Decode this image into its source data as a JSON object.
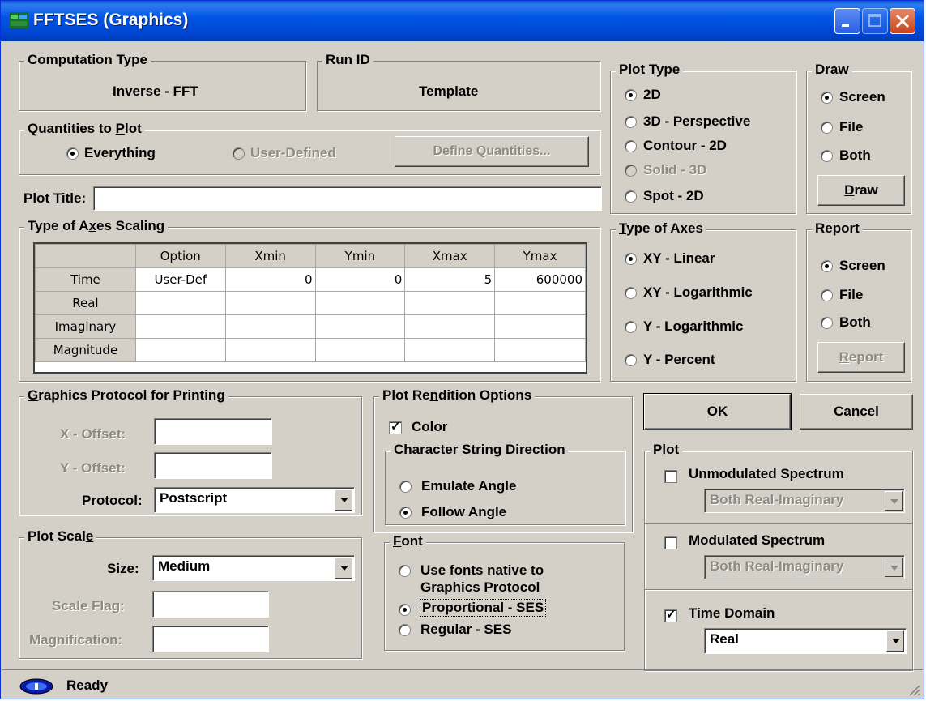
{
  "window": {
    "title": "FFTSES (Graphics)"
  },
  "computation_type": {
    "label": "Computation Type",
    "value": "Inverse - FFT"
  },
  "run_id": {
    "label": "Run ID",
    "value": "Template"
  },
  "quantities": {
    "label_pre": "Quantities to ",
    "label_u": "P",
    "label_post": "lot",
    "everything": "Everything",
    "user_defined": "User-Defined",
    "define_button": "Define Quantities..."
  },
  "plot_title": {
    "label": "Plot Title:",
    "value": ""
  },
  "axes_scaling": {
    "label_pre": "Type of A",
    "label_u": "x",
    "label_post": "es Scaling",
    "headers": [
      "",
      "Option",
      "Xmin",
      "Ymin",
      "Xmax",
      "Ymax"
    ],
    "rows": [
      [
        "Time",
        "User-Def",
        "0",
        "0",
        "5",
        "600000"
      ],
      [
        "Real",
        "",
        "",
        "",
        "",
        ""
      ],
      [
        "Imaginary",
        "",
        "",
        "",
        "",
        ""
      ],
      [
        "Magnitude",
        "",
        "",
        "",
        "",
        ""
      ]
    ]
  },
  "plot_type": {
    "label_pre": "Plot ",
    "label_u": "T",
    "label_post": "ype",
    "options": [
      "2D",
      "3D - Perspective",
      "Contour - 2D",
      "Solid - 3D",
      "Spot - 2D"
    ],
    "selected": "2D"
  },
  "draw": {
    "label_pre": "Dra",
    "label_u": "w",
    "label_post": "",
    "options": [
      "Screen",
      "File",
      "Both"
    ],
    "selected": "Screen",
    "button_u": "D",
    "button_rest": "raw"
  },
  "axes_type": {
    "label_pre": "",
    "label_u": "T",
    "label_post": "ype of Axes",
    "options": [
      "XY - Linear",
      "XY - Logarithmic",
      "Y - Logarithmic",
      "Y - Percent"
    ],
    "selected": "XY - Linear"
  },
  "report": {
    "label": "Report",
    "options": [
      "Screen",
      "File",
      "Both"
    ],
    "selected": "Screen",
    "button_u": "R",
    "button_rest": "eport"
  },
  "graphics_protocol": {
    "label_pre": "",
    "label_u": "G",
    "label_post": "raphics Protocol for Printing",
    "x_offset": "X - Offset:",
    "y_offset": "Y - Offset:",
    "protocol_label": "Protocol:",
    "protocol_value": "Postscript"
  },
  "plot_scale": {
    "label_pre": "Plot Scal",
    "label_u": "e",
    "label_post": "",
    "size_label": "Size:",
    "size_value": "Medium",
    "scale_flag": "Scale Flag:",
    "magnification": "Magnification:"
  },
  "rendition": {
    "label_pre": "Plot Re",
    "label_u": "n",
    "label_post": "dition Options",
    "color": "Color",
    "direction_pre": "Character ",
    "direction_u": "S",
    "direction_post": "tring Direction",
    "emulate": "Emulate Angle",
    "follow": "Follow Angle"
  },
  "font": {
    "label_u": "F",
    "label_post": "ont",
    "native_1": "Use fonts native to",
    "native_2": "Graphics Protocol",
    "proportional": "Proportional - SES",
    "regular": "Regular - SES"
  },
  "buttons": {
    "ok_u": "O",
    "ok_rest": "K",
    "cancel_u": "C",
    "cancel_rest": "ancel"
  },
  "plot": {
    "label_pre": "P",
    "label_u": "l",
    "label_post": "ot",
    "unmodulated": "Unmodulated Spectrum",
    "unmodulated_value": "Both Real-Imaginary",
    "modulated": "Modulated Spectrum",
    "modulated_value": "Both Real-Imaginary",
    "time_domain": "Time Domain",
    "time_domain_value": "Real"
  },
  "status": {
    "text": "Ready"
  }
}
